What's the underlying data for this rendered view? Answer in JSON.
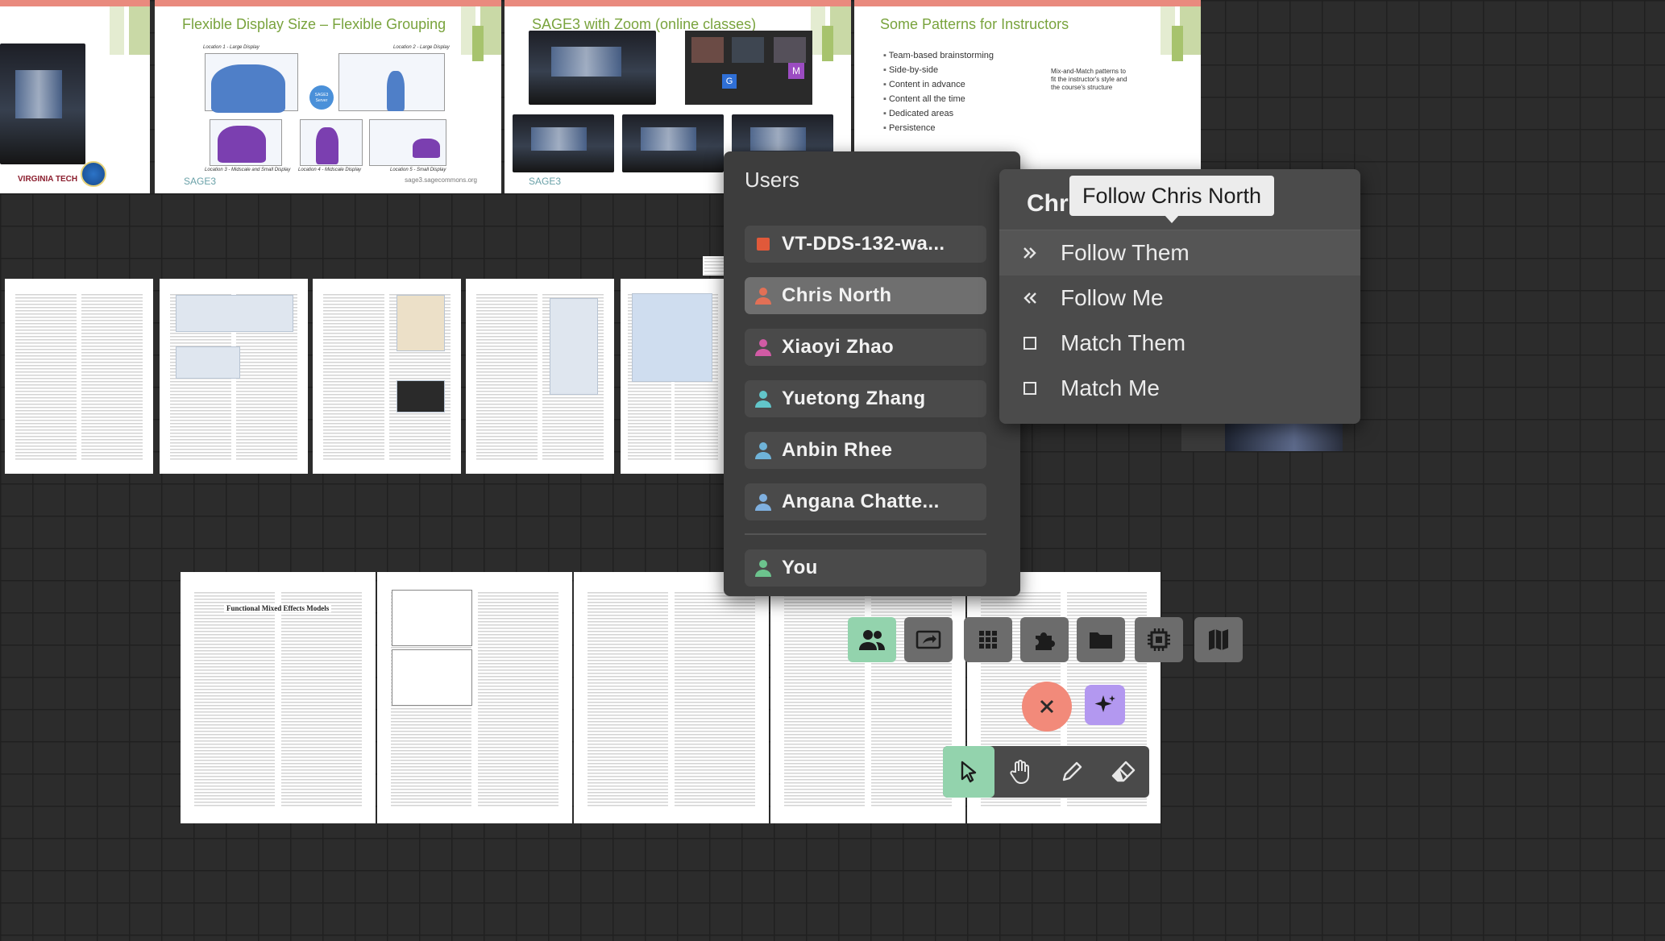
{
  "slides": [
    {
      "title": "",
      "logo_text": "VIRGINIA TECH"
    },
    {
      "title": "Flexible Display Size – Flexible Grouping",
      "labels": [
        "Location 1 - Large Display",
        "Location 2 - Large Display",
        "Location 3 - Midscale and Small Display",
        "Location 4 - Midscale Display",
        "Location 5 - Small Display"
      ],
      "hub": "SAGE3 Server",
      "footer": "SAGE3",
      "footer_right": "sage3.sagecommons.org"
    },
    {
      "title": "SAGE3 with Zoom (online classes)",
      "footer": "SAGE3",
      "zoom_tiles": [
        "G",
        "M"
      ]
    },
    {
      "title": "Some Patterns for Instructors",
      "bullets": [
        "Team-based brainstorming",
        "Side-by-side",
        "Content in advance",
        "Content all the time",
        "Dedicated areas",
        "Persistence"
      ],
      "note": "Mix-and-Match patterns to fit the instructor's style and the course's structure"
    }
  ],
  "paper": {
    "title": "Functional Mixed Effects Models"
  },
  "users_panel": {
    "title": "Users",
    "users": [
      {
        "label": "VT-DDS-132-wa...",
        "color": "#e0593a",
        "kind": "screen"
      },
      {
        "label": "Chris North",
        "color": "#e27056",
        "kind": "person",
        "selected": true
      },
      {
        "label": "Xiaoyi Zhao",
        "color": "#d15ba5",
        "kind": "person"
      },
      {
        "label": "Yuetong Zhang",
        "color": "#62c5c9",
        "kind": "person"
      },
      {
        "label": "Anbin Rhee",
        "color": "#6fb3d8",
        "kind": "person"
      },
      {
        "label": "Angana Chatte...",
        "color": "#7fb0e0",
        "kind": "person"
      },
      {
        "label": "You",
        "color": "#6cc38d",
        "kind": "person"
      }
    ]
  },
  "follow_menu": {
    "header": "Chr",
    "tooltip": "Follow Chris North",
    "items": [
      {
        "label": "Follow Them",
        "icon": "double-chevron-right-icon",
        "highlighted": true
      },
      {
        "label": "Follow Me",
        "icon": "double-chevron-left-icon"
      },
      {
        "label": "Match Them",
        "icon": "square-icon"
      },
      {
        "label": "Match Me",
        "icon": "square-icon"
      }
    ]
  },
  "toolbar": {
    "buttons": [
      "users-icon",
      "share-screen-icon",
      "apps-grid-icon",
      "plugins-icon",
      "folder-icon",
      "chip-icon",
      "map-icon"
    ],
    "close_icon": "close-icon",
    "ai_icon": "sparkles-icon",
    "tools": [
      "pointer-icon",
      "hand-icon",
      "pencil-icon",
      "eraser-icon"
    ],
    "colors": {
      "green": "#93d3ad",
      "close": "#f28a7a",
      "ai": "#b398f0"
    }
  }
}
